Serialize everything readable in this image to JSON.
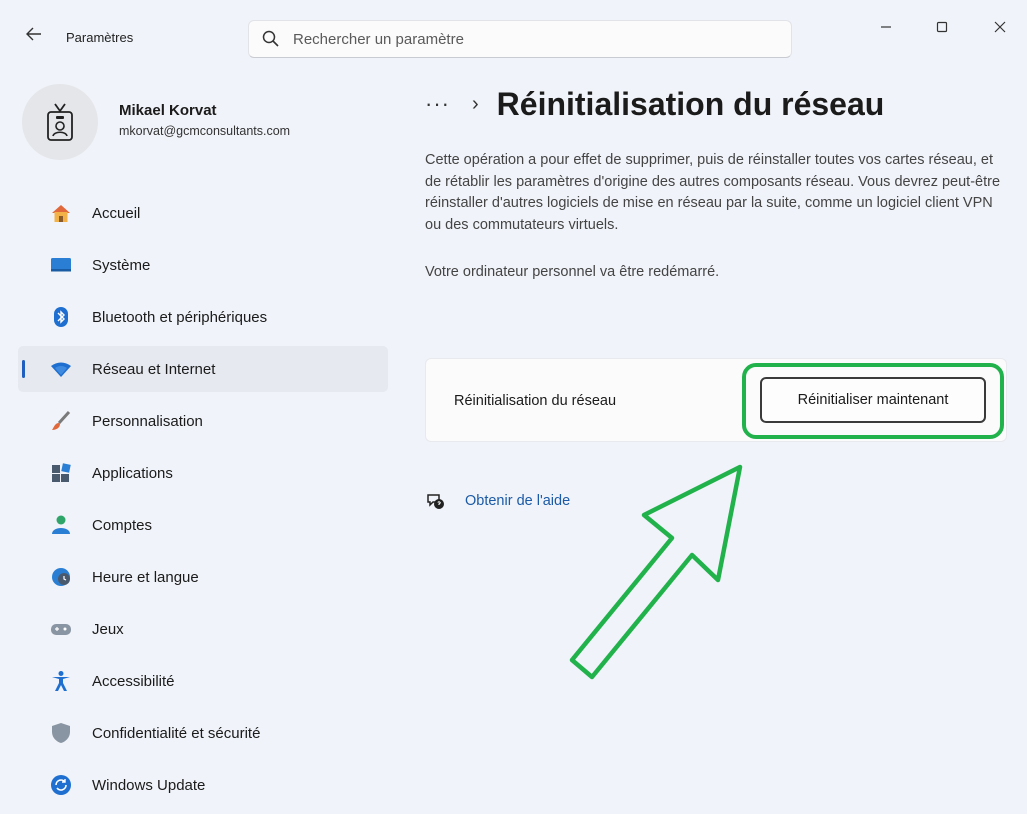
{
  "window": {
    "app_title": "Paramètres",
    "search_placeholder": "Rechercher un paramètre"
  },
  "profile": {
    "name": "Mikael Korvat",
    "email": "mkorvat@gcmconsultants.com"
  },
  "sidebar": {
    "items": [
      {
        "label": "Accueil",
        "icon": "home-icon",
        "selected": false
      },
      {
        "label": "Système",
        "icon": "display-icon",
        "selected": false
      },
      {
        "label": "Bluetooth et périphériques",
        "icon": "bluetooth-icon",
        "selected": false
      },
      {
        "label": "Réseau et Internet",
        "icon": "wifi-icon",
        "selected": true
      },
      {
        "label": "Personnalisation",
        "icon": "brush-icon",
        "selected": false
      },
      {
        "label": "Applications",
        "icon": "apps-icon",
        "selected": false
      },
      {
        "label": "Comptes",
        "icon": "person-icon",
        "selected": false
      },
      {
        "label": "Heure et langue",
        "icon": "globe-clock-icon",
        "selected": false
      },
      {
        "label": "Jeux",
        "icon": "gamepad-icon",
        "selected": false
      },
      {
        "label": "Accessibilité",
        "icon": "accessibility-icon",
        "selected": false
      },
      {
        "label": "Confidentialité et sécurité",
        "icon": "shield-icon",
        "selected": false
      },
      {
        "label": "Windows Update",
        "icon": "update-icon",
        "selected": false
      }
    ]
  },
  "main": {
    "breadcrumb_more": "···",
    "breadcrumb_sep": "›",
    "title": "Réinitialisation du réseau",
    "description": "Cette opération a pour effet de supprimer, puis de réinstaller toutes vos cartes réseau, et de rétablir les paramètres d'origine des autres composants réseau. Vous devrez peut-être réinstaller d'autres logiciels de mise en réseau par la suite, comme un logiciel client VPN ou des commutateurs virtuels.",
    "restart_note": "Votre ordinateur personnel va être redémarré.",
    "card_label": "Réinitialisation du réseau",
    "reset_button": "Réinitialiser maintenant",
    "help_link": "Obtenir de l'aide"
  },
  "colors": {
    "accent": "#1f5fc0",
    "highlight": "#22b24c",
    "link": "#1b5aa6"
  }
}
